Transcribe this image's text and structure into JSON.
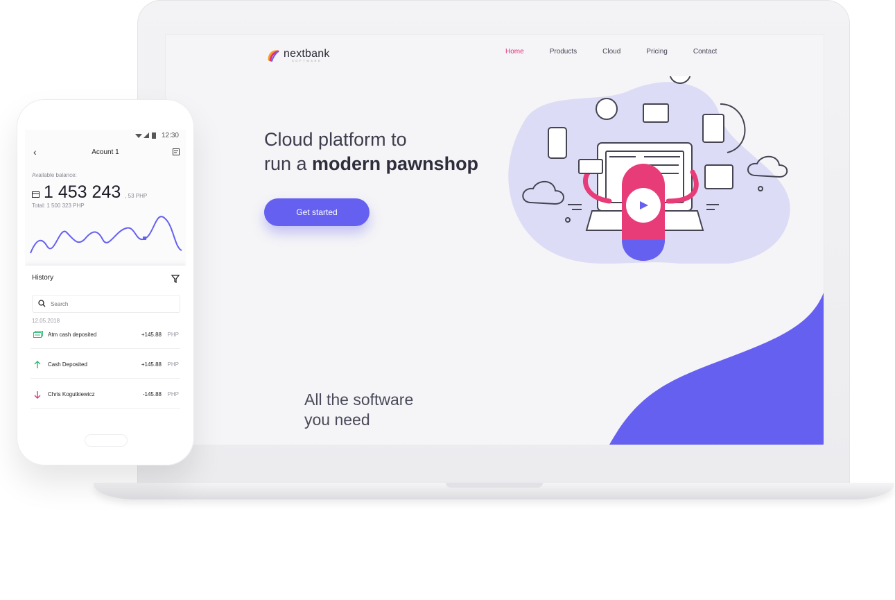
{
  "laptop": {
    "brand": {
      "name": "nextbank",
      "tagline": "SOFTWARE"
    },
    "nav": [
      {
        "label": "Home",
        "active": true
      },
      {
        "label": "Products",
        "active": false
      },
      {
        "label": "Cloud",
        "active": false
      },
      {
        "label": "Pricing",
        "active": false
      },
      {
        "label": "Contact",
        "active": false
      }
    ],
    "hero": {
      "line1": "Cloud platform to",
      "line2_prefix": "run a ",
      "line2_bold": "modern pawnshop"
    },
    "cta_label": "Get started",
    "section_title": {
      "line1": "All the software",
      "line2": "you need"
    },
    "colors": {
      "accent": "#6560f0",
      "brand_pink": "#e0307a",
      "blob": "#dcdcf6"
    }
  },
  "phone": {
    "status_time": "12:30",
    "header_title": "Acount 1",
    "balance_label": "Available balance:",
    "balance_value": "1 453 243",
    "balance_cents": ", 53 PHP",
    "balance_total": "Total: 1 500 323 PHP",
    "history_title": "History",
    "search_placeholder": "Search",
    "date": "12.05.2018",
    "transactions": [
      {
        "name": "Atm cash deposited",
        "amount": "+145.88",
        "currency": "PHP",
        "icon": "cash-icon"
      },
      {
        "name": "Cash Deposited",
        "amount": "+145.88",
        "currency": "PHP",
        "icon": "arrow-up-icon"
      },
      {
        "name": "Chris Kogutkiewicz",
        "amount": "-145.88",
        "currency": "PHP",
        "icon": "arrow-down-icon"
      }
    ]
  }
}
